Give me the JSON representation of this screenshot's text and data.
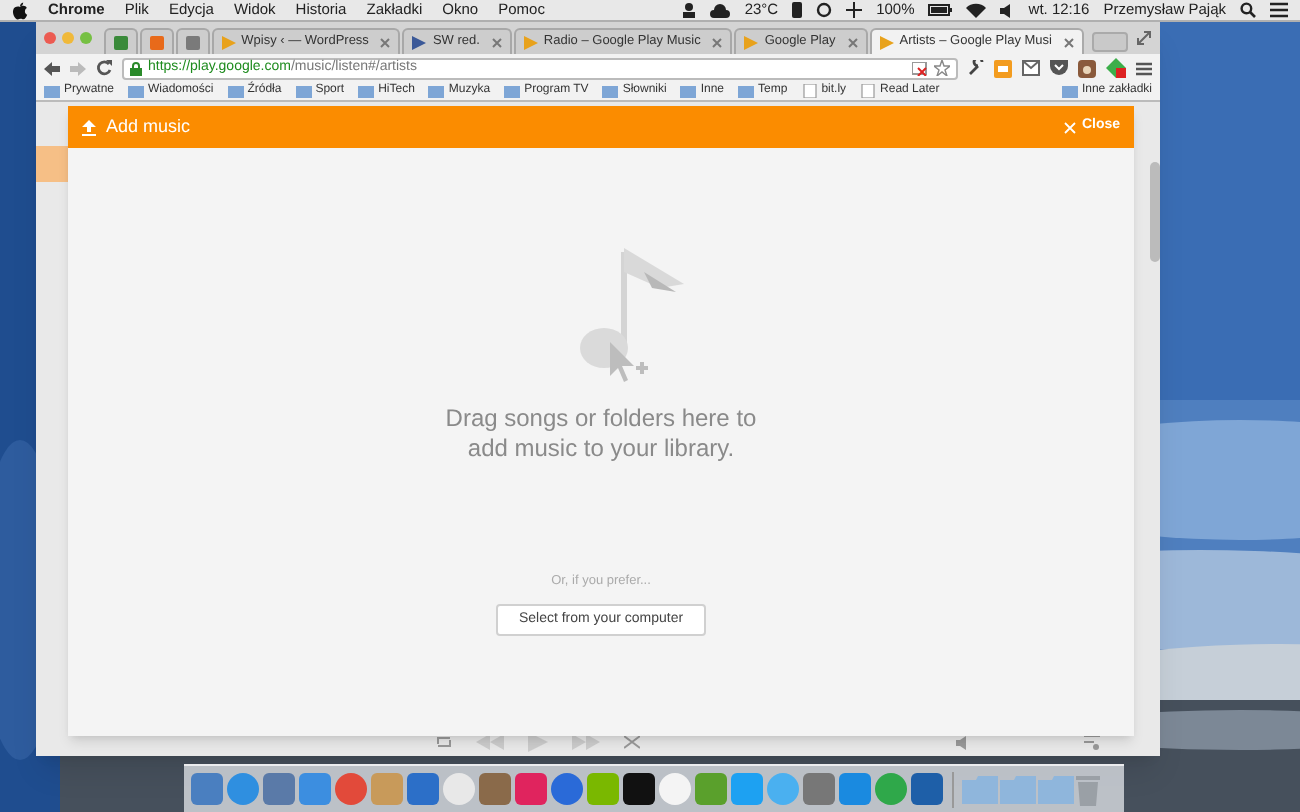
{
  "menu_bar": {
    "items": [
      {
        "label": "Chrome",
        "selected": true
      },
      {
        "label": "Plik",
        "selected": false
      },
      {
        "label": "Edycja",
        "selected": false
      },
      {
        "label": "Widok",
        "selected": false
      },
      {
        "label": "Historia",
        "selected": false
      },
      {
        "label": "Zakładki",
        "selected": false
      },
      {
        "label": "Okno",
        "selected": false
      },
      {
        "label": "Pomoc",
        "selected": false
      }
    ],
    "weather": "23°C",
    "battery": "100%",
    "clock": "wt. 12:16",
    "user": "Przemysław Pająk"
  },
  "tabs": [
    {
      "kind": "pinned",
      "selected": false
    },
    {
      "kind": "pinned",
      "selected": false
    },
    {
      "kind": "pinned",
      "selected": false
    },
    {
      "kind": "tab",
      "label": "Wpisy ‹ — WordPress",
      "selected": false
    },
    {
      "kind": "tab",
      "label": "SW red.",
      "selected": false
    },
    {
      "kind": "tab",
      "label": "Radio – Google Play Music",
      "selected": false
    },
    {
      "kind": "tab",
      "label": "Google Play",
      "selected": false
    },
    {
      "kind": "tab",
      "label": "Artists – Google Play Musi",
      "selected": true
    }
  ],
  "address_bar": {
    "secure_part": "https://play.google.com",
    "path": "/music/listen#/artists"
  },
  "bookmarks": [
    {
      "kind": "folder",
      "label": "Prywatne"
    },
    {
      "kind": "folder",
      "label": "Wiadomości"
    },
    {
      "kind": "folder",
      "label": "Źródła"
    },
    {
      "kind": "folder",
      "label": "Sport"
    },
    {
      "kind": "folder",
      "label": "HiTech"
    },
    {
      "kind": "folder",
      "label": "Muzyka"
    },
    {
      "kind": "folder",
      "label": "Program TV"
    },
    {
      "kind": "folder",
      "label": "Słowniki"
    },
    {
      "kind": "folder",
      "label": "Inne"
    },
    {
      "kind": "folder",
      "label": "Temp"
    },
    {
      "kind": "page",
      "label": "bit.ly"
    },
    {
      "kind": "page",
      "label": "Read Later"
    }
  ],
  "other_bookmarks": "Inne zakładki",
  "dialog": {
    "title": "Add music",
    "close": "Close",
    "message": "Drag songs or folders here to add music to your library.",
    "alternative": "Or, if you prefer...",
    "button": "Select from your computer"
  }
}
